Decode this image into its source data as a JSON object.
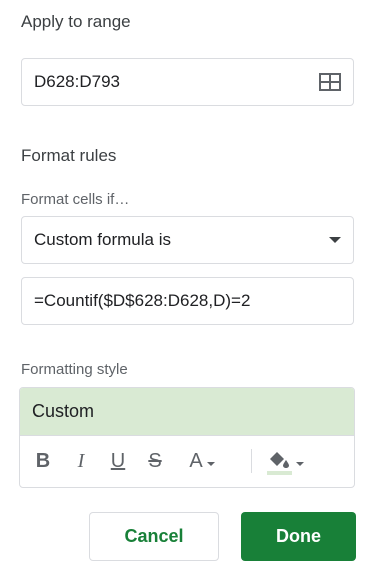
{
  "apply_range": {
    "heading": "Apply to range",
    "value": "D628:D793"
  },
  "format_rules": {
    "heading": "Format rules",
    "condition_label": "Format cells if…",
    "condition_selected": "Custom formula is",
    "formula_value": "=Countif($D$628:D628,D)=2"
  },
  "formatting_style": {
    "label": "Formatting style",
    "preview_text": "Custom",
    "preview_bg": "#d9ead3",
    "toolbar": {
      "bold": "B",
      "italic": "I",
      "underline": "U",
      "strikethrough": "S",
      "text_color": "A",
      "fill_color_swatch": "#d9ead3"
    }
  },
  "actions": {
    "cancel_label": "Cancel",
    "done_label": "Done",
    "accent_color": "#188038"
  }
}
